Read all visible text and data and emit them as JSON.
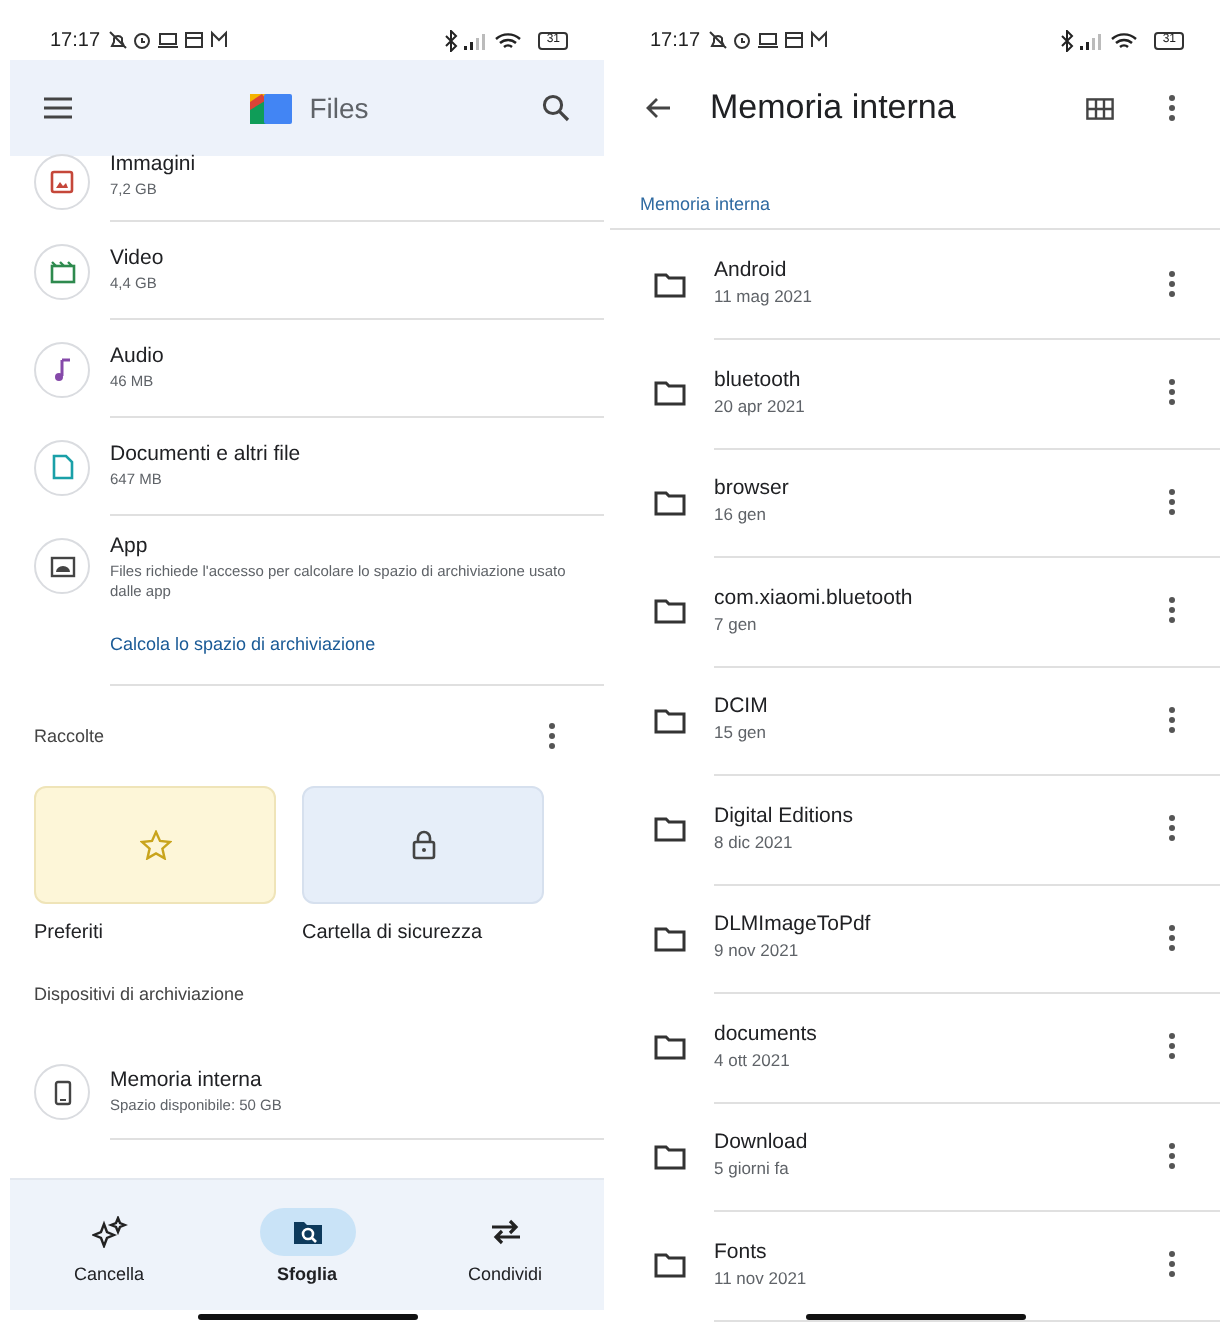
{
  "left_screen": {
    "status_bar": {
      "time": "17:17",
      "battery": "31"
    },
    "app_bar": {
      "title": "Files"
    },
    "categories": [
      {
        "kind": "images",
        "title": "Immagini",
        "subtitle": "7,2 GB"
      },
      {
        "kind": "video",
        "title": "Video",
        "subtitle": "4,4 GB"
      },
      {
        "kind": "audio",
        "title": "Audio",
        "subtitle": "46 MB"
      },
      {
        "kind": "documents",
        "title": "Documenti e altri file",
        "subtitle": "647 MB"
      },
      {
        "kind": "apps",
        "title": "App",
        "subtitle": "Files richiede l'accesso per calcolare lo spazio di archiviazione usato dalle app",
        "link": "Calcola lo spazio di archiviazione"
      }
    ],
    "collections": {
      "heading": "Raccolte",
      "items": [
        {
          "kind": "favorites",
          "label": "Preferiti"
        },
        {
          "kind": "safe",
          "label": "Cartella di sicurezza"
        }
      ]
    },
    "storage": {
      "heading": "Dispositivi di archiviazione",
      "devices": [
        {
          "title": "Memoria interna",
          "subtitle": "Spazio disponibile: 50 GB"
        }
      ]
    },
    "bottom_nav": [
      {
        "kind": "clean",
        "label": "Cancella",
        "selected": false
      },
      {
        "kind": "browse",
        "label": "Sfoglia",
        "selected": true
      },
      {
        "kind": "share",
        "label": "Condividi",
        "selected": false
      }
    ]
  },
  "right_screen": {
    "status_bar": {
      "time": "17:17",
      "battery": "31"
    },
    "toolbar": {
      "title": "Memoria interna"
    },
    "breadcrumb": "Memoria interna",
    "folders": [
      {
        "name": "Android",
        "date": "11 mag 2021"
      },
      {
        "name": "bluetooth",
        "date": "20 apr 2021"
      },
      {
        "name": "browser",
        "date": "16 gen"
      },
      {
        "name": "com.xiaomi.bluetooth",
        "date": "7 gen"
      },
      {
        "name": "DCIM",
        "date": "15 gen"
      },
      {
        "name": "Digital Editions",
        "date": "8 dic 2021"
      },
      {
        "name": "DLMImageToPdf",
        "date": "9 nov 2021"
      },
      {
        "name": "documents",
        "date": "4 ott 2021"
      },
      {
        "name": "Download",
        "date": "5 giorni fa"
      },
      {
        "name": "Fonts",
        "date": "11 nov 2021"
      }
    ]
  }
}
